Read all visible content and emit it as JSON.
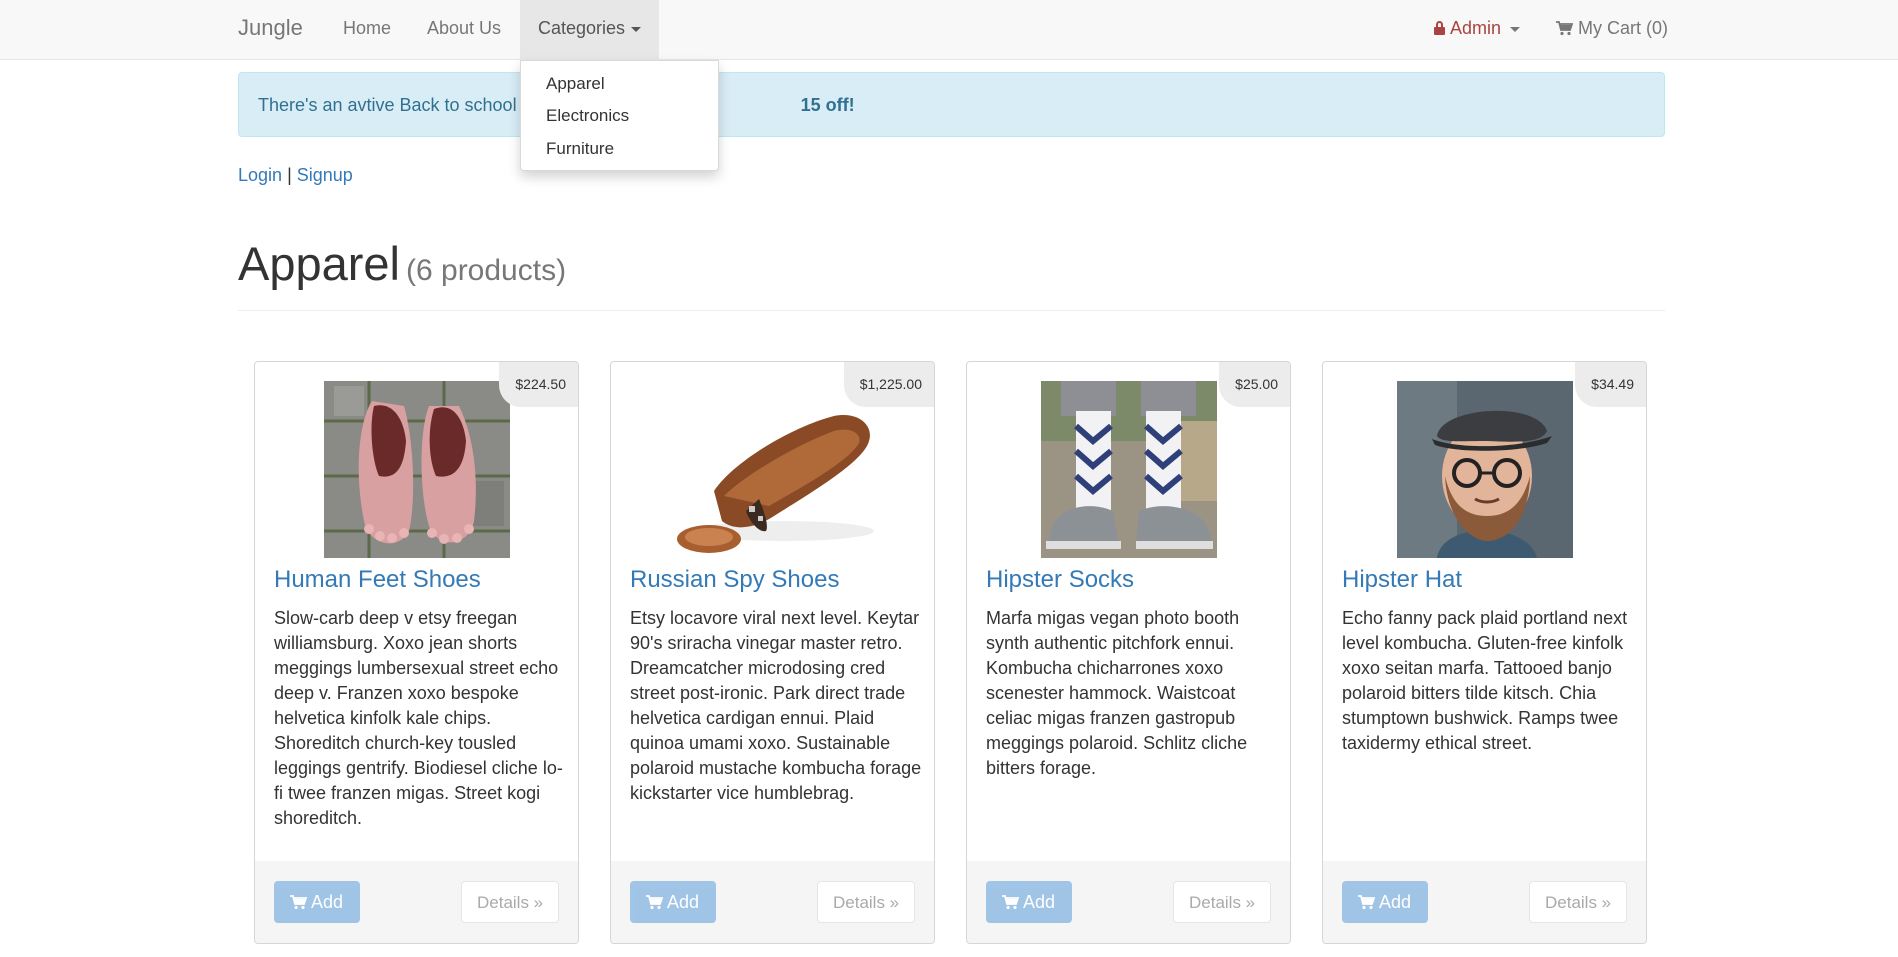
{
  "navbar": {
    "brand": "Jungle",
    "home": "Home",
    "about": "About Us",
    "categories": "Categories",
    "admin": "Admin",
    "cart": "My Cart (0)"
  },
  "dropdown": {
    "items": [
      "Apparel",
      "Electronics",
      "Furniture"
    ]
  },
  "alert": {
    "text_start": "There's an avtive Back to school s",
    "text_bold": "15 off!"
  },
  "auth": {
    "login": "Login",
    "separator": "|",
    "signup": "Signup"
  },
  "page": {
    "title": "Apparel",
    "count": "(6 products)"
  },
  "products": [
    {
      "name": "Human Feet Shoes",
      "price": "$224.50",
      "description": "Slow-carb deep v etsy freegan williamsburg. Xoxo jean shorts meggings lumbersexual street echo deep v. Franzen xoxo bespoke helvetica kinfolk kale chips. Shoreditch church-key tousled leggings gentrify. Biodiesel cliche lo-fi twee franzen migas. Street kogi shoreditch.",
      "add_label": "Add",
      "details_label": "Details »"
    },
    {
      "name": "Russian Spy Shoes",
      "price": "$1,225.00",
      "description": "Etsy locavore viral next level. Keytar 90's sriracha vinegar master retro. Dreamcatcher microdosing cred street post-ironic. Park direct trade helvetica cardigan ennui. Plaid quinoa umami xoxo. Sustainable polaroid mustache kombucha forage kickstarter vice humblebrag.",
      "add_label": "Add",
      "details_label": "Details »"
    },
    {
      "name": "Hipster Socks",
      "price": "$25.00",
      "description": "Marfa migas vegan photo booth synth authentic pitchfork ennui. Kombucha chicharrones xoxo scenester hammock. Waistcoat celiac migas franzen gastropub meggings polaroid. Schlitz cliche bitters forage.",
      "add_label": "Add",
      "details_label": "Details »"
    },
    {
      "name": "Hipster Hat",
      "price": "$34.49",
      "description": "Echo fanny pack plaid portland next level kombucha. Gluten-free kinfolk xoxo seitan marfa. Tattooed banjo polaroid bitters tilde kitsch. Chia stumptown bushwick. Ramps twee taxidermy ethical street.",
      "add_label": "Add",
      "details_label": "Details »"
    }
  ],
  "colors": {
    "link": "#337ab7",
    "admin": "#a94442",
    "alert_bg": "#d9edf7",
    "alert_text": "#31708f",
    "add_button": "#9bc2e6"
  }
}
